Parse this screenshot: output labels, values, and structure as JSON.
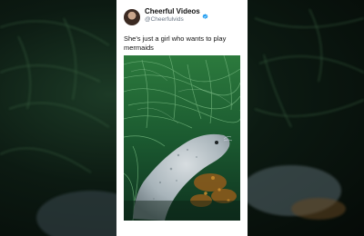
{
  "post": {
    "display_name": "Cheerful Videos",
    "handle": "@Cheerfulvids",
    "caption": "She's just a girl who wants to play mermaids",
    "verified": true,
    "avatar_icon": "profile-photo-avatar",
    "verified_icon": "verified-badge-icon"
  },
  "colors": {
    "card_bg": "#ffffff",
    "verified_blue": "#1d9bf0",
    "background": "#0b1410"
  }
}
